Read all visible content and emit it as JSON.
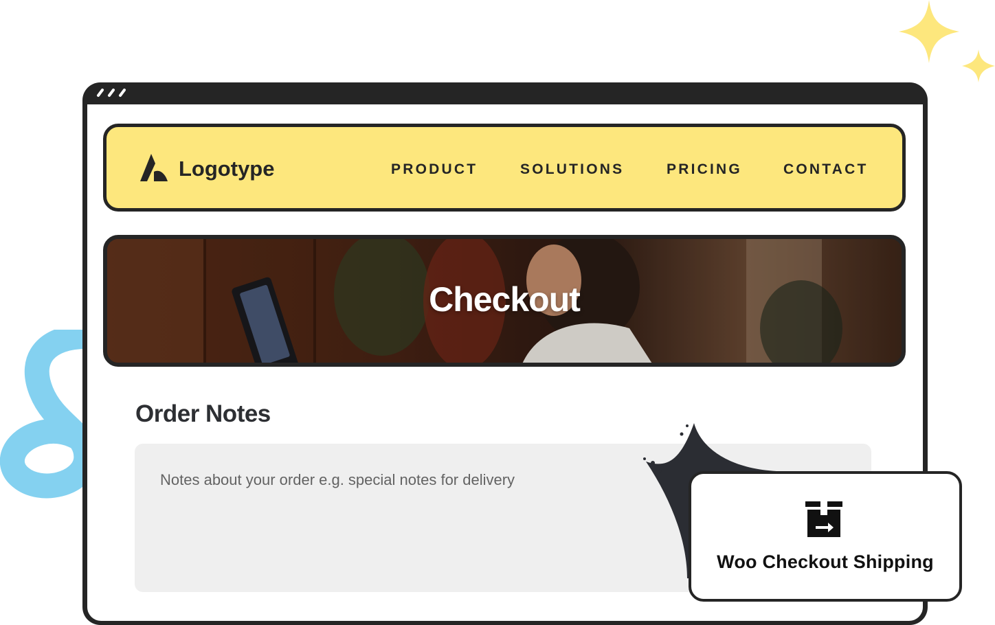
{
  "header": {
    "logo_text": "Logotype",
    "nav": [
      {
        "label": "PRODUCT"
      },
      {
        "label": "SOLUTIONS"
      },
      {
        "label": "PRICING"
      },
      {
        "label": "CONTACT"
      }
    ]
  },
  "hero": {
    "title": "Checkout"
  },
  "order_notes": {
    "title": "Order Notes",
    "placeholder": "Notes about your order e.g. special notes for delivery",
    "value": ""
  },
  "card": {
    "label": "Woo Checkout Shipping",
    "icon": "shipping-box-icon"
  },
  "colors": {
    "header_bg": "#FDE77D",
    "frame": "#252525",
    "notes_bg": "#EFEFEF",
    "squiggle": "#7DCFEF",
    "sparkle": "#FDE77D"
  }
}
